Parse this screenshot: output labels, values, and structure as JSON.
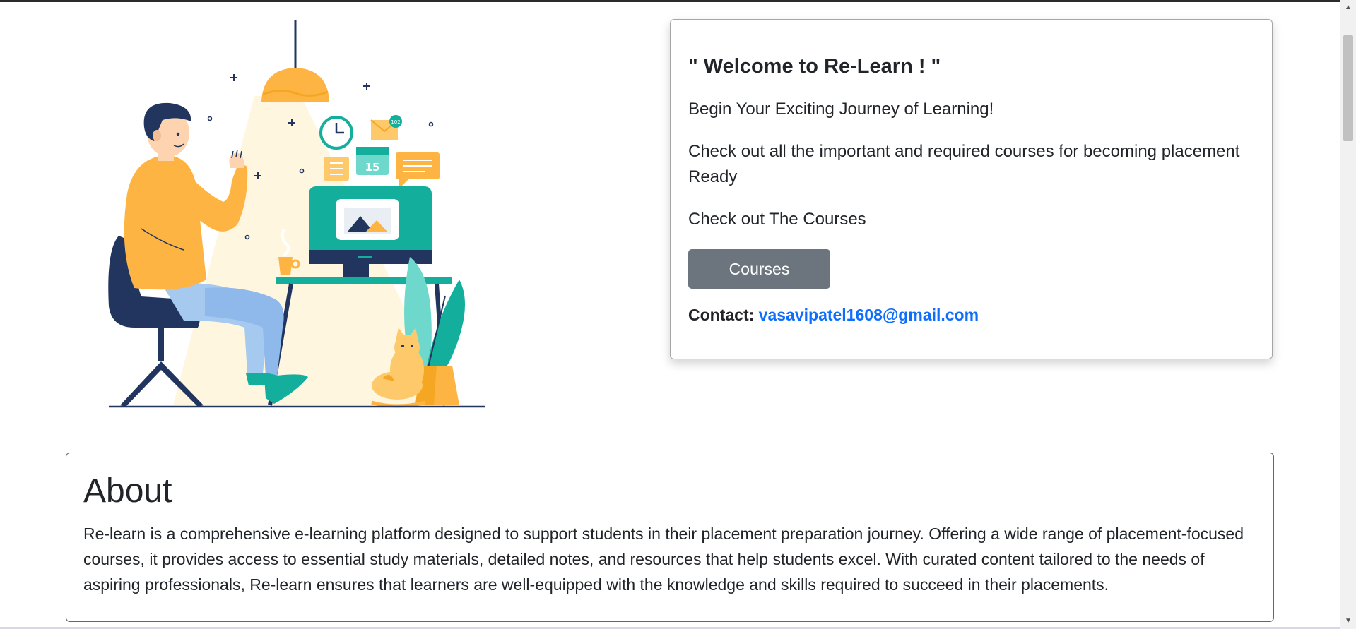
{
  "hero": {
    "calendar_day": "15",
    "notification_count": "102"
  },
  "welcome": {
    "title": "\" Welcome to Re-Learn ! \"",
    "subtitle": "Begin Your Exciting Journey of Learning!",
    "description": "Check out all the important and required courses for becoming placement Ready",
    "cta_text": "Check out The Courses",
    "courses_button_label": "Courses",
    "contact_label": "Contact:",
    "contact_email": "vasavipatel1608@gmail.com"
  },
  "about": {
    "heading": "About",
    "body": "Re-learn is a comprehensive e-learning platform designed to support students in their placement preparation journey. Offering a wide range of placement-focused courses, it provides access to essential study materials, detailed notes, and resources that help students excel. With curated content tailored to the needs of aspiring professionals, Re-learn ensures that learners are well-equipped with the knowledge and skills required to succeed in their placements."
  },
  "scrollbar": {
    "up_icon": "scroll-up-arrow",
    "down_icon": "scroll-down-arrow"
  },
  "colors": {
    "button_bg": "#6c757d",
    "link": "#0d6efd",
    "illustration_orange": "#fdb443",
    "illustration_teal": "#13ae9c",
    "illustration_navy": "#22355f"
  }
}
